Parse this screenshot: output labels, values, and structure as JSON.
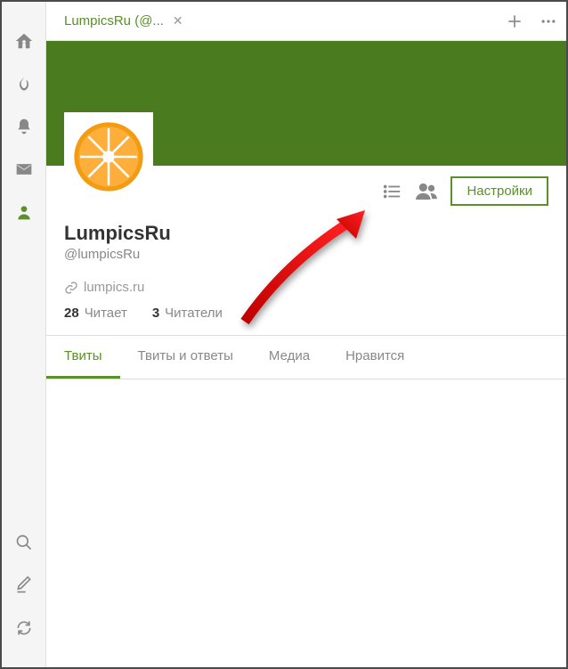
{
  "tab": {
    "title": "LumpicsRu (@..."
  },
  "profile": {
    "display_name": "LumpicsRu",
    "handle": "@lumpicsRu",
    "site": "lumpics.ru",
    "following_count": "28",
    "following_label": "Читает",
    "followers_count": "3",
    "followers_label": "Читатели"
  },
  "buttons": {
    "settings": "Настройки"
  },
  "ptabs": {
    "tweets": "Твиты",
    "replies": "Твиты и ответы",
    "media": "Медиа",
    "likes": "Нравится"
  }
}
